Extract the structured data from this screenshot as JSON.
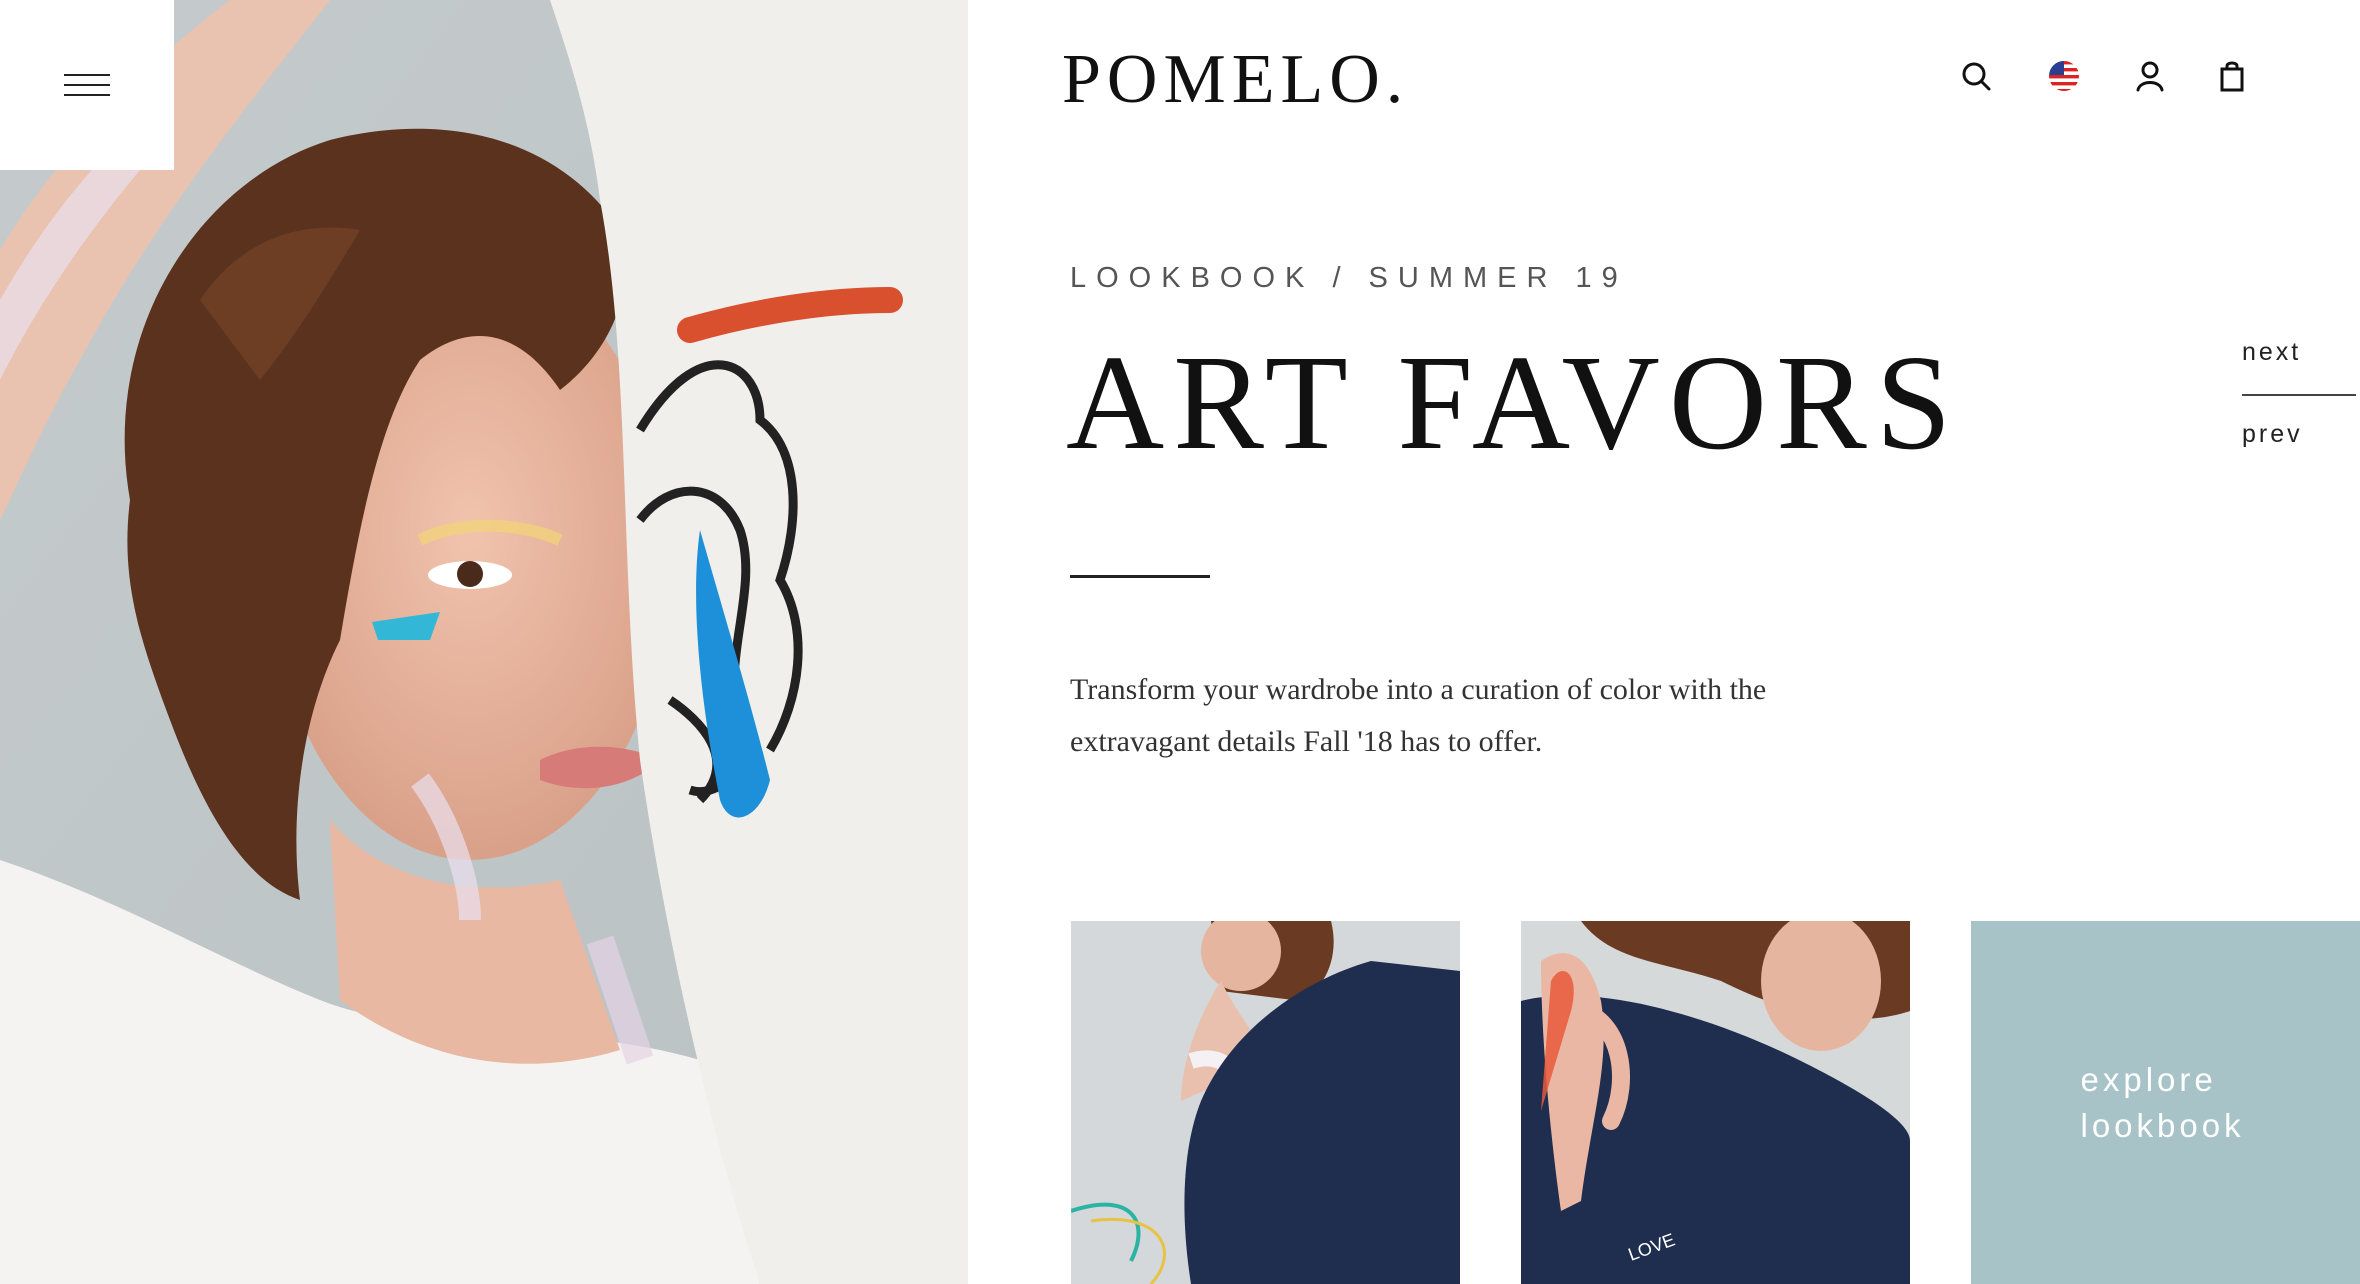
{
  "brand": {
    "logo": "POMELO."
  },
  "header": {
    "icons": [
      "search-icon",
      "us-flag-icon",
      "user-icon",
      "shopping-bag-icon"
    ]
  },
  "hero": {
    "eyebrow": "LOOKBOOK / SUMMER 19",
    "title": "ART FAVORS",
    "description": "Transform your wardrobe into a curation of color with the extravagant details Fall '18 has to offer."
  },
  "pager": {
    "next": "next",
    "prev": "prev"
  },
  "cta": {
    "explore": "explore lookbook"
  },
  "colors": {
    "accent_tile": "#a7c3c8",
    "text_dark": "#111111",
    "denim": "#1f2d4e",
    "paint_orange": "#d9502f",
    "paint_blue": "#1e8fd9"
  }
}
